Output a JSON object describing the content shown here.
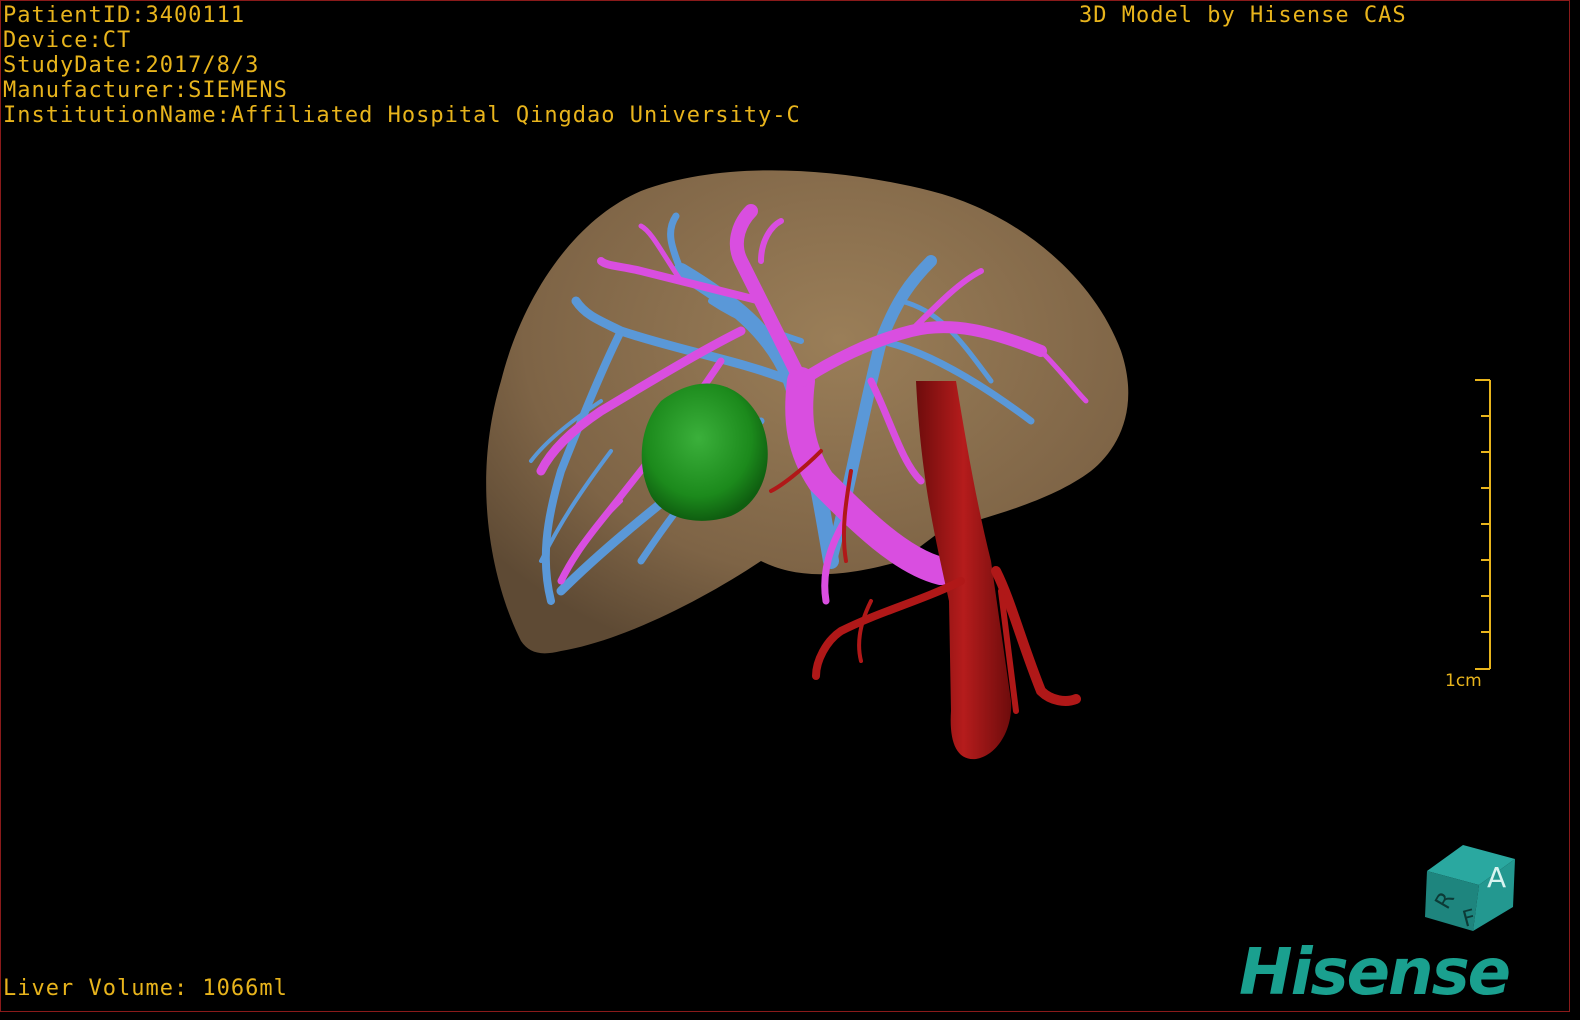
{
  "overlay": {
    "patient_id": "PatientID:3400111",
    "device": "Device:CT",
    "study_date": "StudyDate:2017/8/3",
    "manufacturer": "Manufacturer:SIEMENS",
    "institution": "InstitutionName:Affiliated Hospital Qingdao University-C",
    "credit": "3D Model by Hisense CAS",
    "liver_volume": "Liver Volume: 1066ml"
  },
  "scale": {
    "label": "1cm"
  },
  "orientation_cube": {
    "icon": "orientation-cube-icon",
    "faces": [
      "A",
      "F",
      "R"
    ]
  },
  "brand": {
    "name": "Hisense"
  },
  "colors": {
    "text": "#e8b41c",
    "liver": "#8a7050",
    "portal_vein": "#d94ee0",
    "hepatic_vein": "#5a98d8",
    "artery": "#b01818",
    "tumor": "#1e8a1e",
    "brand": "#1aa08f"
  }
}
